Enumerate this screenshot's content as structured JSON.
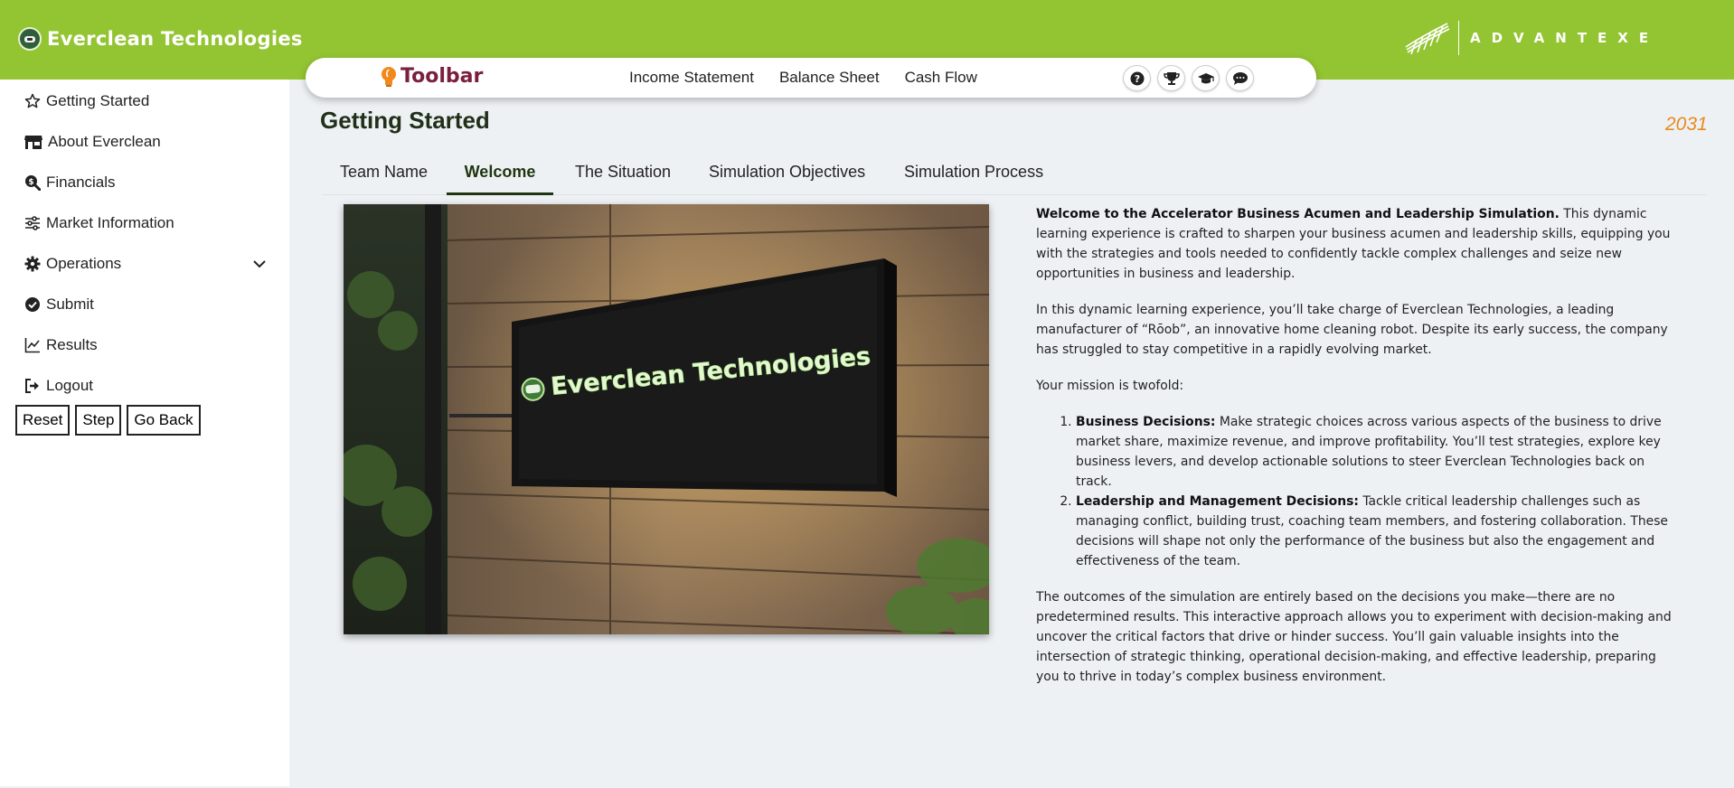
{
  "header": {
    "brand_name": "Everclean Technologies",
    "partner_logo_text": "ADVANTEXE",
    "bg_color": "#93c432"
  },
  "toolbar": {
    "title": "Toolbar",
    "links": [
      "Income Statement",
      "Balance Sheet",
      "Cash Flow"
    ],
    "icons": [
      "help-icon",
      "trophy-icon",
      "graduation-cap-icon",
      "chat-icon"
    ]
  },
  "sidebar": {
    "items": [
      {
        "label": "Getting Started",
        "icon": "star-icon"
      },
      {
        "label": "About Everclean",
        "icon": "store-icon"
      },
      {
        "label": "Financials",
        "icon": "search-dollar-icon"
      },
      {
        "label": "Market Information",
        "icon": "sliders-icon"
      },
      {
        "label": "Operations",
        "icon": "gear-icon"
      },
      {
        "label": "Submit",
        "icon": "check-circle-icon"
      },
      {
        "label": "Results",
        "icon": "line-chart-icon"
      },
      {
        "label": "Logout",
        "icon": "sign-out-icon"
      }
    ],
    "buttons": [
      "Reset",
      "Step",
      "Go Back"
    ]
  },
  "main": {
    "page_title": "Getting Started",
    "year": "2031",
    "tabs": [
      "Team Name",
      "Welcome",
      "The Situation",
      "Simulation Objectives",
      "Simulation Process"
    ],
    "active_tab": "Welcome",
    "hero_sign_text": "Everclean Technologies",
    "content": {
      "intro_bold": "Welcome to the Accelerator Business Acumen and Leadership Simulation.",
      "intro_rest": " This dynamic learning experience is crafted to sharpen your business acumen and leadership skills, equipping you with the strategies and tools needed to confidently tackle complex challenges and seize new opportunities in business and leadership.",
      "para2": "In this dynamic learning experience, you’ll take charge of Everclean Technologies, a leading manufacturer of “Rōob”, an innovative home cleaning robot. Despite its early success, the company has struggled to stay competitive in a rapidly evolving market.",
      "para3": "Your mission is twofold:",
      "list": [
        {
          "bold": "Business Decisions:",
          "text": " Make strategic choices across various aspects of the business to drive market share, maximize revenue, and improve profitability. You’ll test strategies, explore key business levers, and develop actionable solutions to steer Everclean Technologies back on track."
        },
        {
          "bold": "Leadership and Management Decisions:",
          "text": " Tackle critical leadership challenges such as managing conflict, building trust, coaching team members, and fostering collaboration. These decisions will shape not only the performance of the business but also the engagement and effectiveness of the team."
        }
      ],
      "para4": "The outcomes of the simulation are entirely based on the decisions you make—there are no predetermined results. This interactive approach allows you to experiment with decision-making and uncover the critical factors that drive or hinder success. You’ll gain valuable insights into the intersection of strategic thinking, operational decision-making, and effective leadership, preparing you to thrive in today’s complex business environment."
    }
  },
  "colors": {
    "accent_green": "#93c432",
    "year_orange": "#e98a1f",
    "toolbar_title": "#7a1f3f",
    "active_tab": "#1f3410"
  }
}
